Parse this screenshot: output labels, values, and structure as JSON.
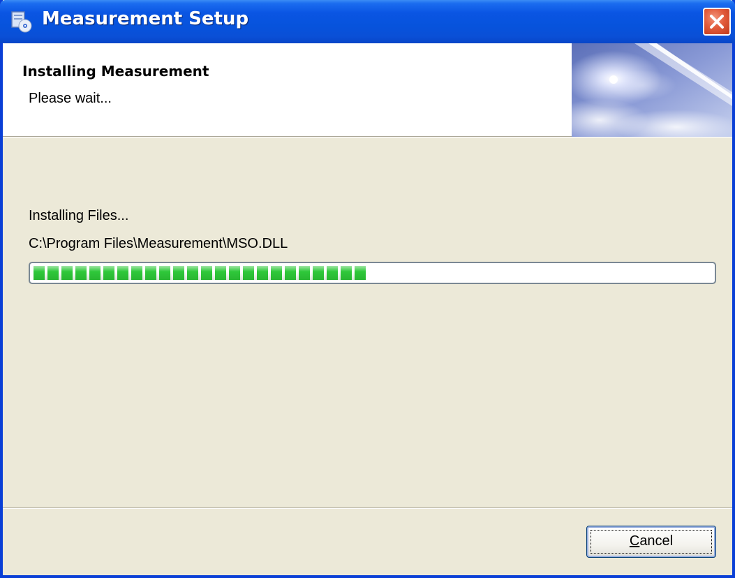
{
  "window": {
    "title": "Measurement Setup",
    "app_icon": "setup-cd-icon",
    "close_icon": "close-icon"
  },
  "header": {
    "title": "Installing Measurement",
    "subtitle": "Please wait...",
    "image": "space-nebula-banner"
  },
  "progress": {
    "status": "Installing Files...",
    "current_file": "C:\\Program Files\\Measurement\\MSO.DLL",
    "fraction": 0.5
  },
  "buttons": {
    "cancel_mnemonic": "C",
    "cancel_rest": "ancel"
  },
  "colors": {
    "titlebar": "#0a55e3",
    "progress_green": "#2fc83a",
    "dialog_background": "#ece9d8"
  }
}
